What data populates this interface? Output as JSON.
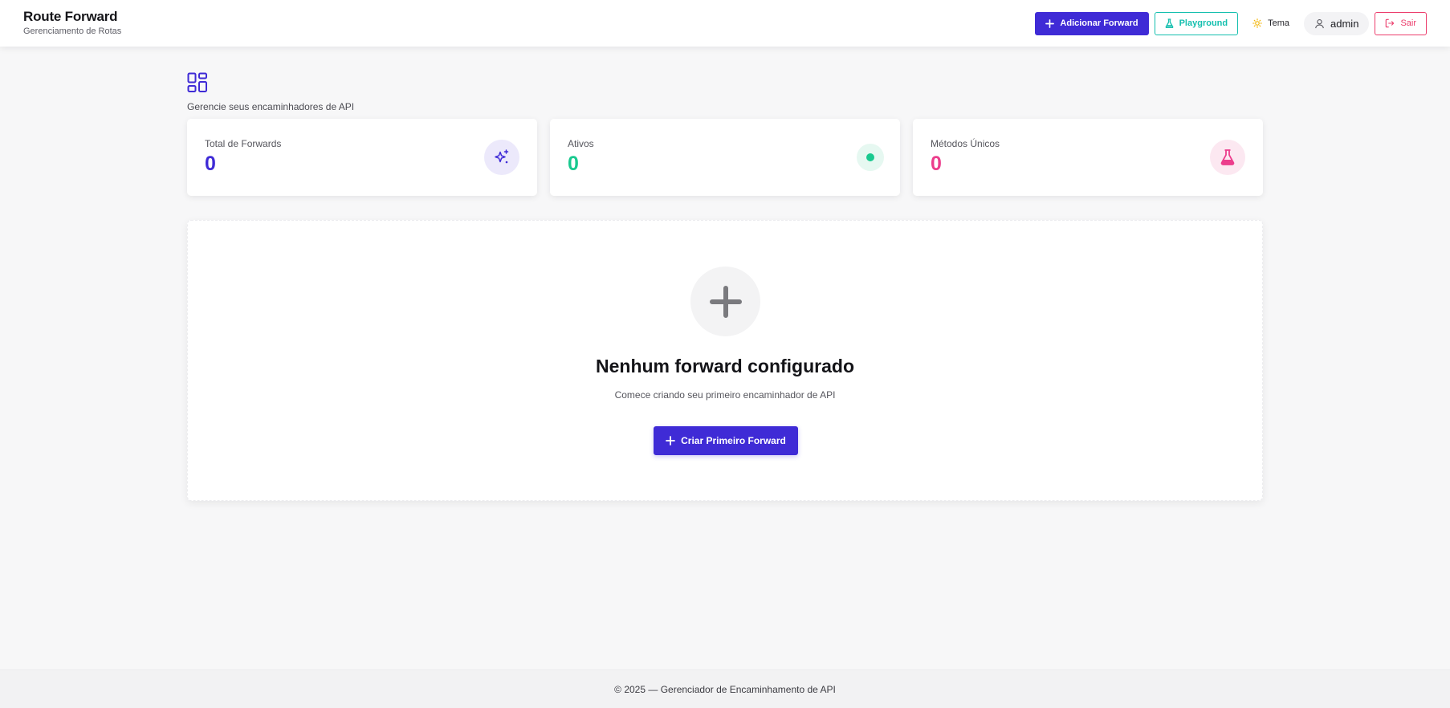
{
  "header": {
    "title": "Route Forward",
    "subtitle": "Gerenciamento de Rotas",
    "actions": {
      "add_forward": "Adicionar Forward",
      "playground": "Playground",
      "theme": "Tema",
      "user": "admin",
      "logout": "Sair"
    }
  },
  "main": {
    "header_icon": "dashboard-grid-icon",
    "subtitle": "Gerencie seus encaminhadores de API",
    "stats": [
      {
        "label": "Total de Forwards",
        "value": "0",
        "color": "#3f2bd6",
        "icon": "sparkles-icon"
      },
      {
        "label": "Ativos",
        "value": "0",
        "color": "#19c98f",
        "icon": "status-dot-icon"
      },
      {
        "label": "Métodos Únicos",
        "value": "0",
        "color": "#ec3d8c",
        "icon": "flask-icon"
      }
    ],
    "empty_state": {
      "icon": "plus-icon",
      "title": "Nenhum forward configurado",
      "description": "Comece criando seu primeiro encaminhador de API",
      "button": "Criar Primeiro Forward"
    }
  },
  "footer": {
    "text": "© 2025 — Gerenciador de Encaminhamento de API"
  },
  "colors": {
    "primary": "#3f2bd6",
    "teal": "#14bfae",
    "danger": "#ec3d6c",
    "success": "#19c98f",
    "pink": "#ec3d8c"
  }
}
